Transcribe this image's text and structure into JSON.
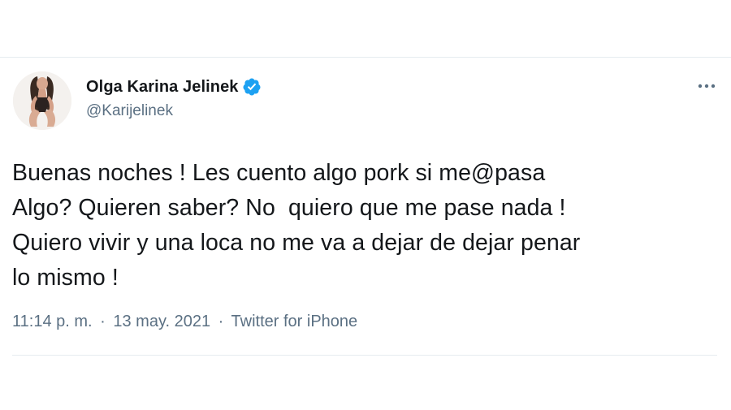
{
  "tweet": {
    "author": {
      "display_name": "Olga Karina Jelinek",
      "handle": "@Karijelinek",
      "verified": true
    },
    "text": "Buenas noches ! Les cuento algo pork si me@pasa\nAlgo? Quieren saber? No  quiero que me pase nada !\nQuiero vivir y una loca no me va a dejar de dejar penar\nlo mismo !",
    "time": "11:14 p. m.",
    "date": "13 may. 2021",
    "separator": "·",
    "source": "Twitter for iPhone"
  },
  "icons": {
    "verified": "verified-badge-icon",
    "more": "more-options-icon"
  },
  "colors": {
    "verified_blue": "#1da1f2",
    "text_primary": "#14171a",
    "text_secondary": "#5b7083",
    "divider": "#e6ecf0"
  }
}
